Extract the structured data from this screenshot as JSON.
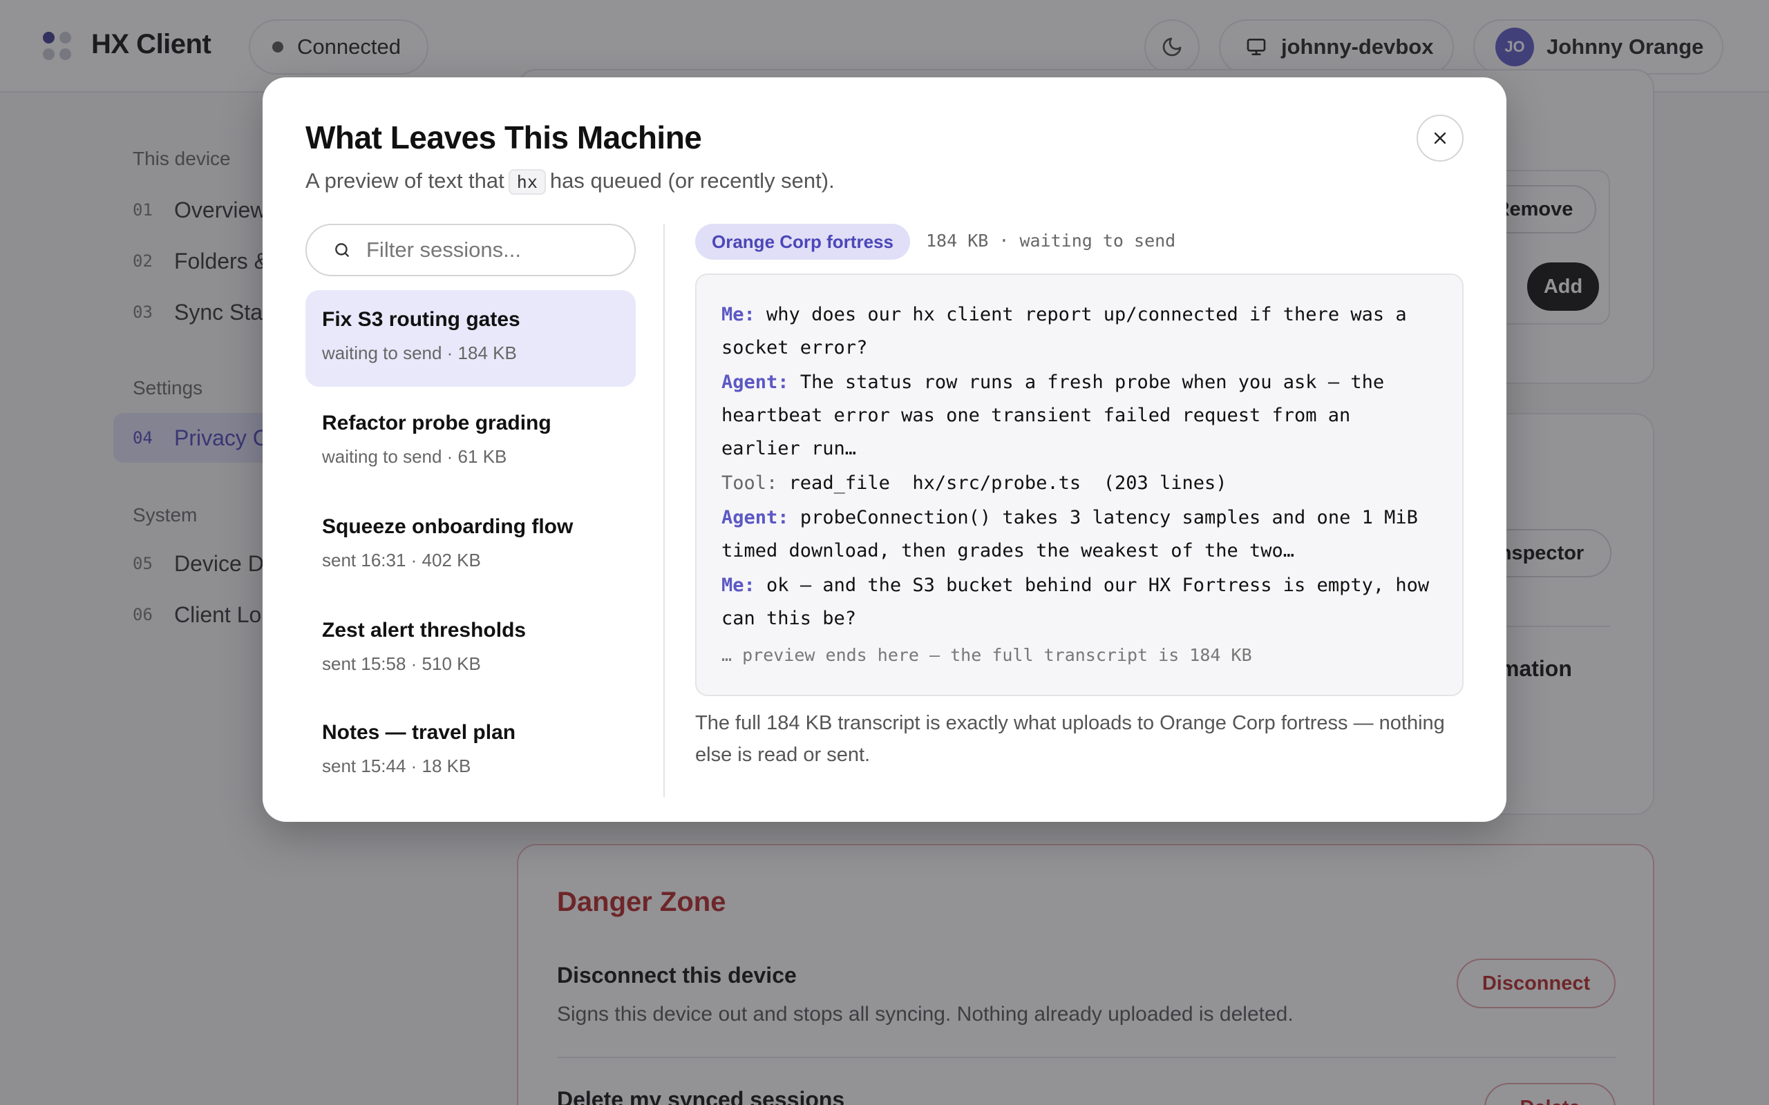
{
  "header": {
    "app_title": "HX Client",
    "status": "Connected",
    "device": "johnny-devbox",
    "user_initials": "JO",
    "user_name": "Johnny Orange"
  },
  "sidebar": {
    "sections": [
      {
        "label": "This device",
        "items": [
          {
            "num": "01",
            "label": "Overview"
          },
          {
            "num": "02",
            "label": "Folders &"
          },
          {
            "num": "03",
            "label": "Sync Sta"
          }
        ]
      },
      {
        "label": "Settings",
        "items": [
          {
            "num": "04",
            "label": "Privacy C",
            "active": true
          }
        ]
      },
      {
        "label": "System",
        "items": [
          {
            "num": "05",
            "label": "Device D"
          },
          {
            "num": "06",
            "label": "Client Lo"
          }
        ]
      }
    ]
  },
  "background": {
    "remove_label": "Remove",
    "add_label": "Add",
    "inspector_label": "nspector",
    "mation_label": "mation",
    "danger_title": "Danger Zone",
    "disconnect_title": "Disconnect this device",
    "disconnect_desc": "Signs this device out and stops all syncing. Nothing already uploaded is deleted.",
    "disconnect_label": "Disconnect",
    "delete_title": "Delete my synced sessions",
    "delete_label": "Delete"
  },
  "modal": {
    "title": "What Leaves This Machine",
    "subtitle_pre": "A preview of text that",
    "subtitle_code": "hx",
    "subtitle_post": "has queued (or recently sent).",
    "filter_placeholder": "Filter sessions...",
    "sessions": [
      {
        "title": "Fix S3 routing gates",
        "meta": "waiting to send · 184 KB",
        "active": true
      },
      {
        "title": "Refactor probe grading",
        "meta": "waiting to send · 61 KB"
      },
      {
        "title": "Squeeze onboarding flow",
        "meta": "sent 16:31 · 402 KB"
      },
      {
        "title": "Zest alert thresholds",
        "meta": "sent 15:58 · 510 KB"
      },
      {
        "title": "Notes — travel plan",
        "meta": "sent 15:44 · 18 KB"
      }
    ],
    "destination": "Orange Corp fortress",
    "destination_meta": "184 KB · waiting to send",
    "transcript": [
      {
        "speaker": "Me:",
        "kind": "me",
        "text": "why does our hx client report up/connected if there was a socket error?"
      },
      {
        "speaker": "Agent:",
        "kind": "agent",
        "text": "The status row runs a fresh probe when you ask — the heartbeat error was one transient failed request from an earlier run…"
      },
      {
        "speaker": "Tool:",
        "kind": "tool",
        "text": "read_file  hx/src/probe.ts  (203 lines)"
      },
      {
        "speaker": "Agent:",
        "kind": "agent",
        "text": "probeConnection() takes 3 latency samples and one 1 MiB timed download, then grades the weakest of the two…"
      },
      {
        "speaker": "Me:",
        "kind": "me",
        "text": "ok — and the S3 bucket behind our HX Fortress is empty, how can this be?"
      }
    ],
    "preview_end": "… preview ends here — the full transcript is 184 KB",
    "footnote": "The full 184 KB transcript is exactly what uploads to Orange Corp fortress — nothing else is read or sent."
  }
}
